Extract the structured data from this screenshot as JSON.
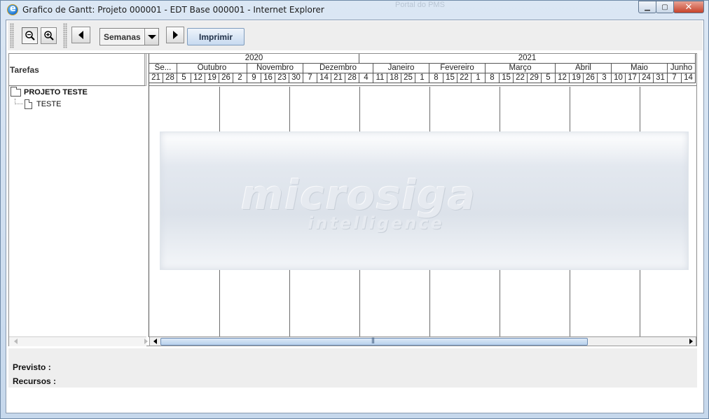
{
  "window": {
    "title": "Grafico de Gantt: Projeto 000001 - EDT Base 000001 - Internet Explorer",
    "background_title": "Portal do PMS"
  },
  "toolbar": {
    "zoom_out_icon": "zoom-out-icon",
    "zoom_in_icon": "zoom-in-icon",
    "scale_value": "Semanas",
    "print_label": "Imprimir"
  },
  "gantt": {
    "tasks_header": "Tarefas",
    "years": [
      "2020",
      "2021"
    ],
    "months": [
      "Se...",
      "Outubro",
      "Novembro",
      "Dezembro",
      "Janeiro",
      "Fevereiro",
      "Março",
      "Abril",
      "Maio",
      "Junho"
    ],
    "weeks": [
      "21",
      "28",
      "5",
      "12",
      "19",
      "26",
      "2",
      "9",
      "16",
      "23",
      "30",
      "7",
      "14",
      "21",
      "28",
      "4",
      "11",
      "18",
      "25",
      "1",
      "8",
      "15",
      "22",
      "1",
      "8",
      "15",
      "22",
      "29",
      "5",
      "12",
      "19",
      "26",
      "3",
      "10",
      "17",
      "24",
      "31",
      "7",
      "14"
    ],
    "tree": {
      "root": "PROJETO TESTE",
      "child": "TESTE"
    },
    "watermark": {
      "brand": "microsiga",
      "sub": "intelligence"
    }
  },
  "footer": {
    "previsto_label": "Previsto  :",
    "recursos_label": "Recursos  :"
  },
  "colors": {
    "window_frame": "#c6d8ec",
    "toolbar_bg": "#eeeeee",
    "print_button": "#c8daf0",
    "close_button": "#c7432b"
  }
}
